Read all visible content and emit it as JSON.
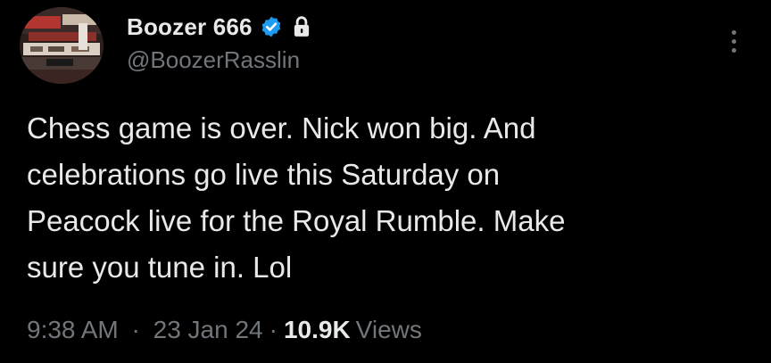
{
  "author": {
    "display_name": "Boozer 666",
    "handle": "@BoozerRasslin",
    "verified_icon": "verified-badge-icon",
    "lock_icon": "lock-icon",
    "avatar": "avatar"
  },
  "tweet": {
    "text": "Chess game is over. Nick won big. And\ncelebrations go live this Saturday on\nPeacock live for the Royal Rumble. Make\nsure you tune in. Lol"
  },
  "meta": {
    "time": "9:38 AM",
    "separator": "·",
    "date": "23 Jan 24",
    "views_count": "10.9K",
    "views_label": "Views"
  },
  "colors": {
    "background": "#000000",
    "text_primary": "#e7e9ea",
    "text_secondary": "#71767b",
    "verified_blue": "#1d9bf0"
  }
}
